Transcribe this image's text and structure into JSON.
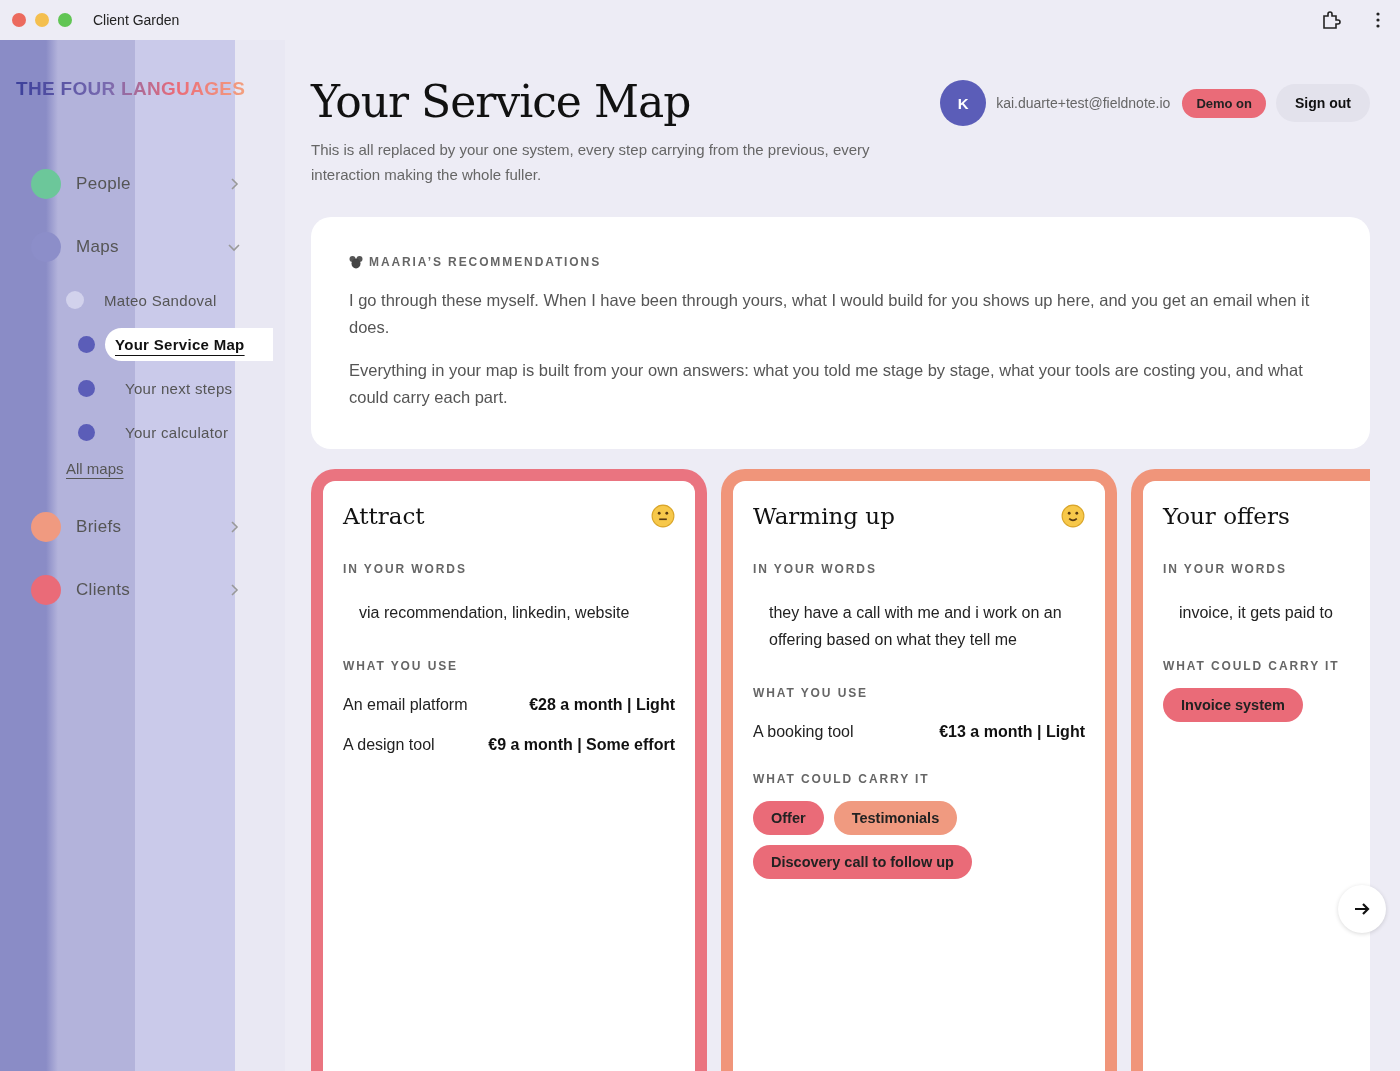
{
  "window": {
    "title": "Client Garden"
  },
  "sidebar": {
    "logo": "THE FOUR LANGUAGES",
    "items": [
      {
        "label": "People",
        "color": "#6cc79a",
        "expanded": false
      },
      {
        "label": "Maps",
        "color": "#8c8ec9",
        "expanded": true,
        "children": [
          {
            "label": "Mateo Sandoval",
            "children": [
              {
                "label": "Your Service Map",
                "selected": true
              },
              {
                "label": "Your next steps",
                "selected": false
              },
              {
                "label": "Your calculator",
                "selected": false
              }
            ]
          }
        ],
        "link": "All maps"
      },
      {
        "label": "Briefs",
        "color": "#f09a80",
        "expanded": false
      },
      {
        "label": "Clients",
        "color": "#ea6b78",
        "expanded": false
      }
    ]
  },
  "header": {
    "title": "Your Service Map",
    "subtitle": "This is all replaced by your one system, every step carrying from the previous, every interaction making the whole fuller.",
    "user": {
      "initial": "K",
      "email": "kai.duarte+test@fieldnote.io"
    },
    "demo_badge": "Demo on",
    "sign_out": "Sign out"
  },
  "recommendations": {
    "heading": "MAARIA’S RECOMMENDATIONS",
    "paragraphs": [
      "I go through these myself. When I have been through yours, what I would build for you shows up here, and you get an email when it does.",
      "Everything in your map is built from your own answers: what you told me stage by stage, what your tools are costing you, and what could carry each part."
    ]
  },
  "stages": [
    {
      "title": "Attract",
      "smiling": false,
      "color": "#ea7480",
      "words_label": "IN YOUR WORDS",
      "words": "via recommendation, linkedin, website",
      "tools_label": "WHAT YOU USE",
      "tools": [
        {
          "name": "An email platform",
          "cost": "€28 a month | Light"
        },
        {
          "name": "A design tool",
          "cost": "€9 a month | Some effort"
        }
      ]
    },
    {
      "title": "Warming up",
      "smiling": true,
      "color": "#f0957a",
      "words_label": "IN YOUR WORDS",
      "words": "they have a call with me and i work on an offering based on what they tell me",
      "tools_label": "WHAT YOU USE",
      "tools": [
        {
          "name": "A booking tool",
          "cost": "€13 a month | Light"
        }
      ],
      "carry_label": "WHAT COULD CARRY IT",
      "carriers": [
        {
          "label": "Offer",
          "color": "#ea6b78"
        },
        {
          "label": "Testimonials",
          "color": "#f09a80"
        },
        {
          "label": "Discovery call to follow up",
          "color": "#ea6b78"
        }
      ]
    },
    {
      "title": "Your offers",
      "color": "#f0957a",
      "words_label": "IN YOUR WORDS",
      "words": "invoice, it gets paid to",
      "carry_label": "WHAT COULD CARRY IT",
      "carriers": [
        {
          "label": "Invoice system",
          "color": "#ea6b78"
        }
      ]
    }
  ]
}
